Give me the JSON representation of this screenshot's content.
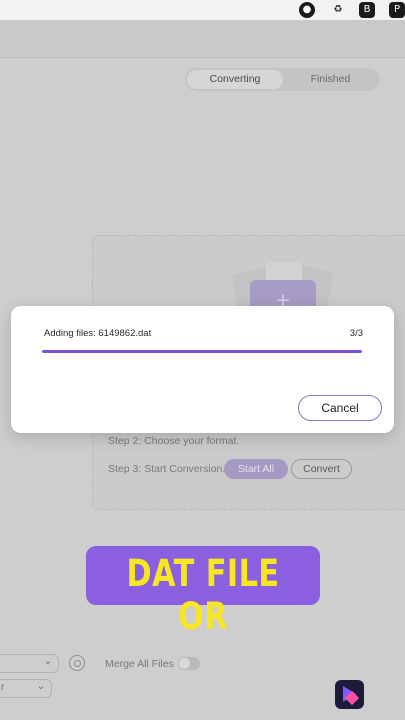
{
  "menubar": {
    "icons": [
      "record-icon",
      "sync-icon",
      "app-badge-icon",
      "pdf-icon"
    ]
  },
  "app": {
    "tabs": [
      {
        "label": "Converting",
        "active": true
      },
      {
        "label": "Finished",
        "active": false
      }
    ],
    "steps": {
      "step2": "Step 2: Choose your format.",
      "step3": "Step 3: Start Conversion."
    },
    "buttons": {
      "start_all": "Start  All",
      "convert": "Convert"
    },
    "bottom": {
      "merge_label": "Merge All Files",
      "merge_enabled": false,
      "select1_value": "",
      "select2_value": "r"
    }
  },
  "dialog": {
    "message": "Adding files: 6149862.dat",
    "count": "3/3",
    "progress_percent": 100,
    "cancel_label": "Cancel"
  },
  "caption": {
    "text": "DAT FILE OR",
    "text_color": "#f6e624",
    "background": "#8a5fe0"
  },
  "colors": {
    "accent": "#7a50d8",
    "dim_overlay": "#cfcfd1"
  }
}
